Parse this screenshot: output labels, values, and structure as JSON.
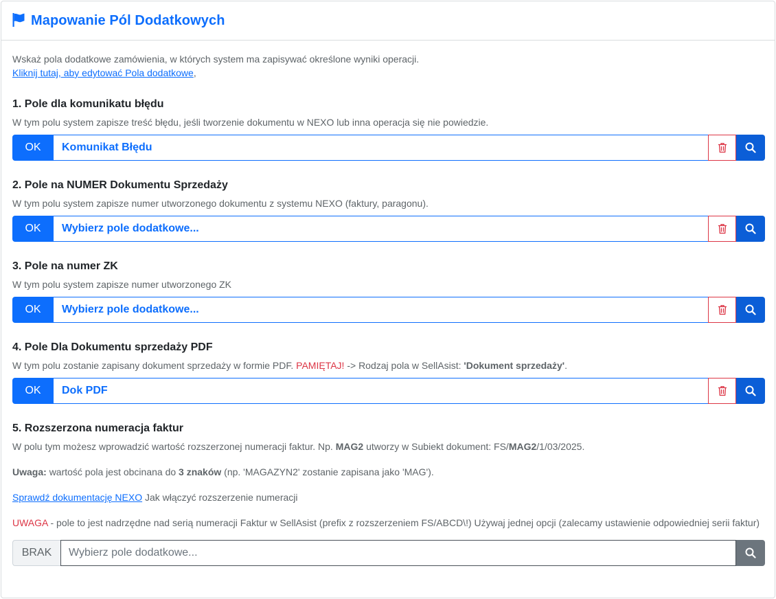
{
  "header": {
    "title": "Mapowanie Pól Dodatkowych",
    "icon": "flag-icon"
  },
  "intro": {
    "text": "Wskaż pola dodatkowe zamówienia, w których system ma zapisywać określone wyniki operacji.",
    "link": "Kliknij tutaj, aby edytować Pola dodatkowe",
    "link_suffix": ","
  },
  "sections": [
    {
      "title": "1. Pole dla komunikatu błędu",
      "desc": "W tym polu system zapisze treść błędu, jeśli tworzenie dokumentu w NEXO lub inna operacja się nie powiedzie.",
      "status": "OK",
      "value": "Komunikat Błędu"
    },
    {
      "title": "2. Pole na NUMER Dokumentu Sprzedaży",
      "desc": "W tym polu system zapisze numer utworzonego dokumentu z systemu NEXO (faktury, paragonu).",
      "status": "OK",
      "value": "Wybierz pole dodatkowe..."
    },
    {
      "title": "3. Pole na numer ZK",
      "desc": "W tym polu system zapisze numer utworzonego ZK",
      "status": "OK",
      "value": "Wybierz pole dodatkowe..."
    },
    {
      "title": "4. Pole Dla Dokumentu sprzedaży PDF",
      "desc_start": "W tym polu zostanie zapisany dokument sprzedaży w formie PDF.",
      "desc_warn": "PAMIĘTAJ!",
      "desc_mid": "-> Rodzaj pola w SellAsist:",
      "desc_bold": "'Dokument sprzedaży'",
      "desc_end": ".",
      "status": "OK",
      "value": "Dok PDF"
    }
  ],
  "section5": {
    "title": "5. Rozszerzona numeracja faktur",
    "p1_a": "W polu tym możesz wprowadzić wartość rozszerzonej numeracji faktur. Np.",
    "p1_b": "MAG2",
    "p1_c": "utworzy w Subiekt dokument: FS/",
    "p1_d": "MAG2",
    "p1_e": "/1/03/2025.",
    "p2_label": "Uwaga:",
    "p2_a": "wartość pola jest obcinana do",
    "p2_b": "3 znaków",
    "p2_c": "(np. 'MAGAZYN2' zostanie zapisana jako 'MAG').",
    "p3_link": "Sprawdź dokumentację NEXO",
    "p3_text": "Jak włączyć rozszerzenie numeracji",
    "p4_warn": "UWAGA",
    "p4_text": "- pole to jest nadrzędne nad serią numeracji Faktur w SellAsist (prefix z rozszerzeniem FS/ABCD\\!) Używaj jednej opcji (zalecamy ustawienie odpowiedniej serii faktur)",
    "status": "BRAK",
    "placeholder": "Wybierz pole dodatkowe..."
  },
  "colors": {
    "primary": "#0d6efd",
    "danger": "#dc3545",
    "secondary": "#6c757d"
  }
}
